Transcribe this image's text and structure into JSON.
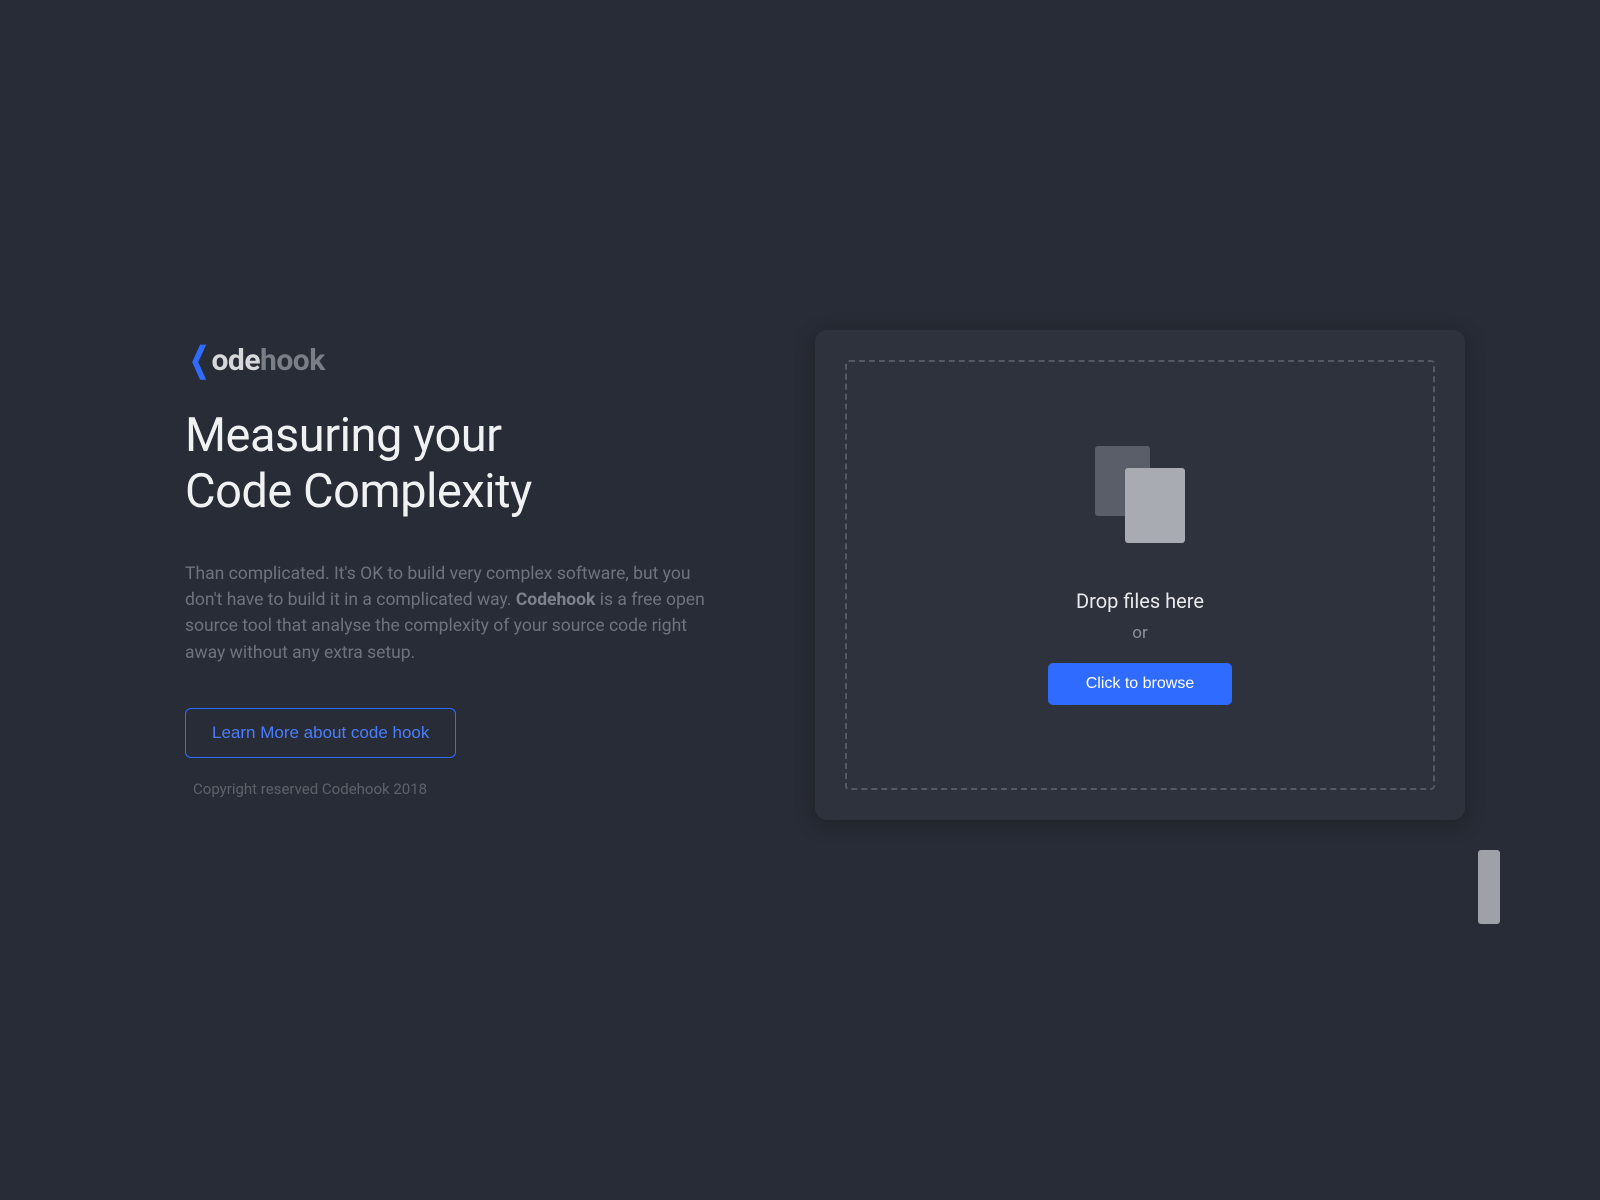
{
  "logo": {
    "part1": "ode",
    "part2": "hook"
  },
  "headline_line1": "Measuring your",
  "headline_line2": "Code Complexity",
  "description": {
    "text_before": "Than complicated. It's OK to build very complex software, but you don't have to build it in a complicated way. ",
    "bold": "Codehook",
    "text_after": " is a free open source tool that analyse the complexity of your source code right away without any extra setup."
  },
  "learn_more_button": "Learn More about code hook",
  "copyright": "Copyright reserved Codehook 2018",
  "dropzone": {
    "title": "Drop files here",
    "or": "or",
    "browse_button": "Click to browse"
  }
}
